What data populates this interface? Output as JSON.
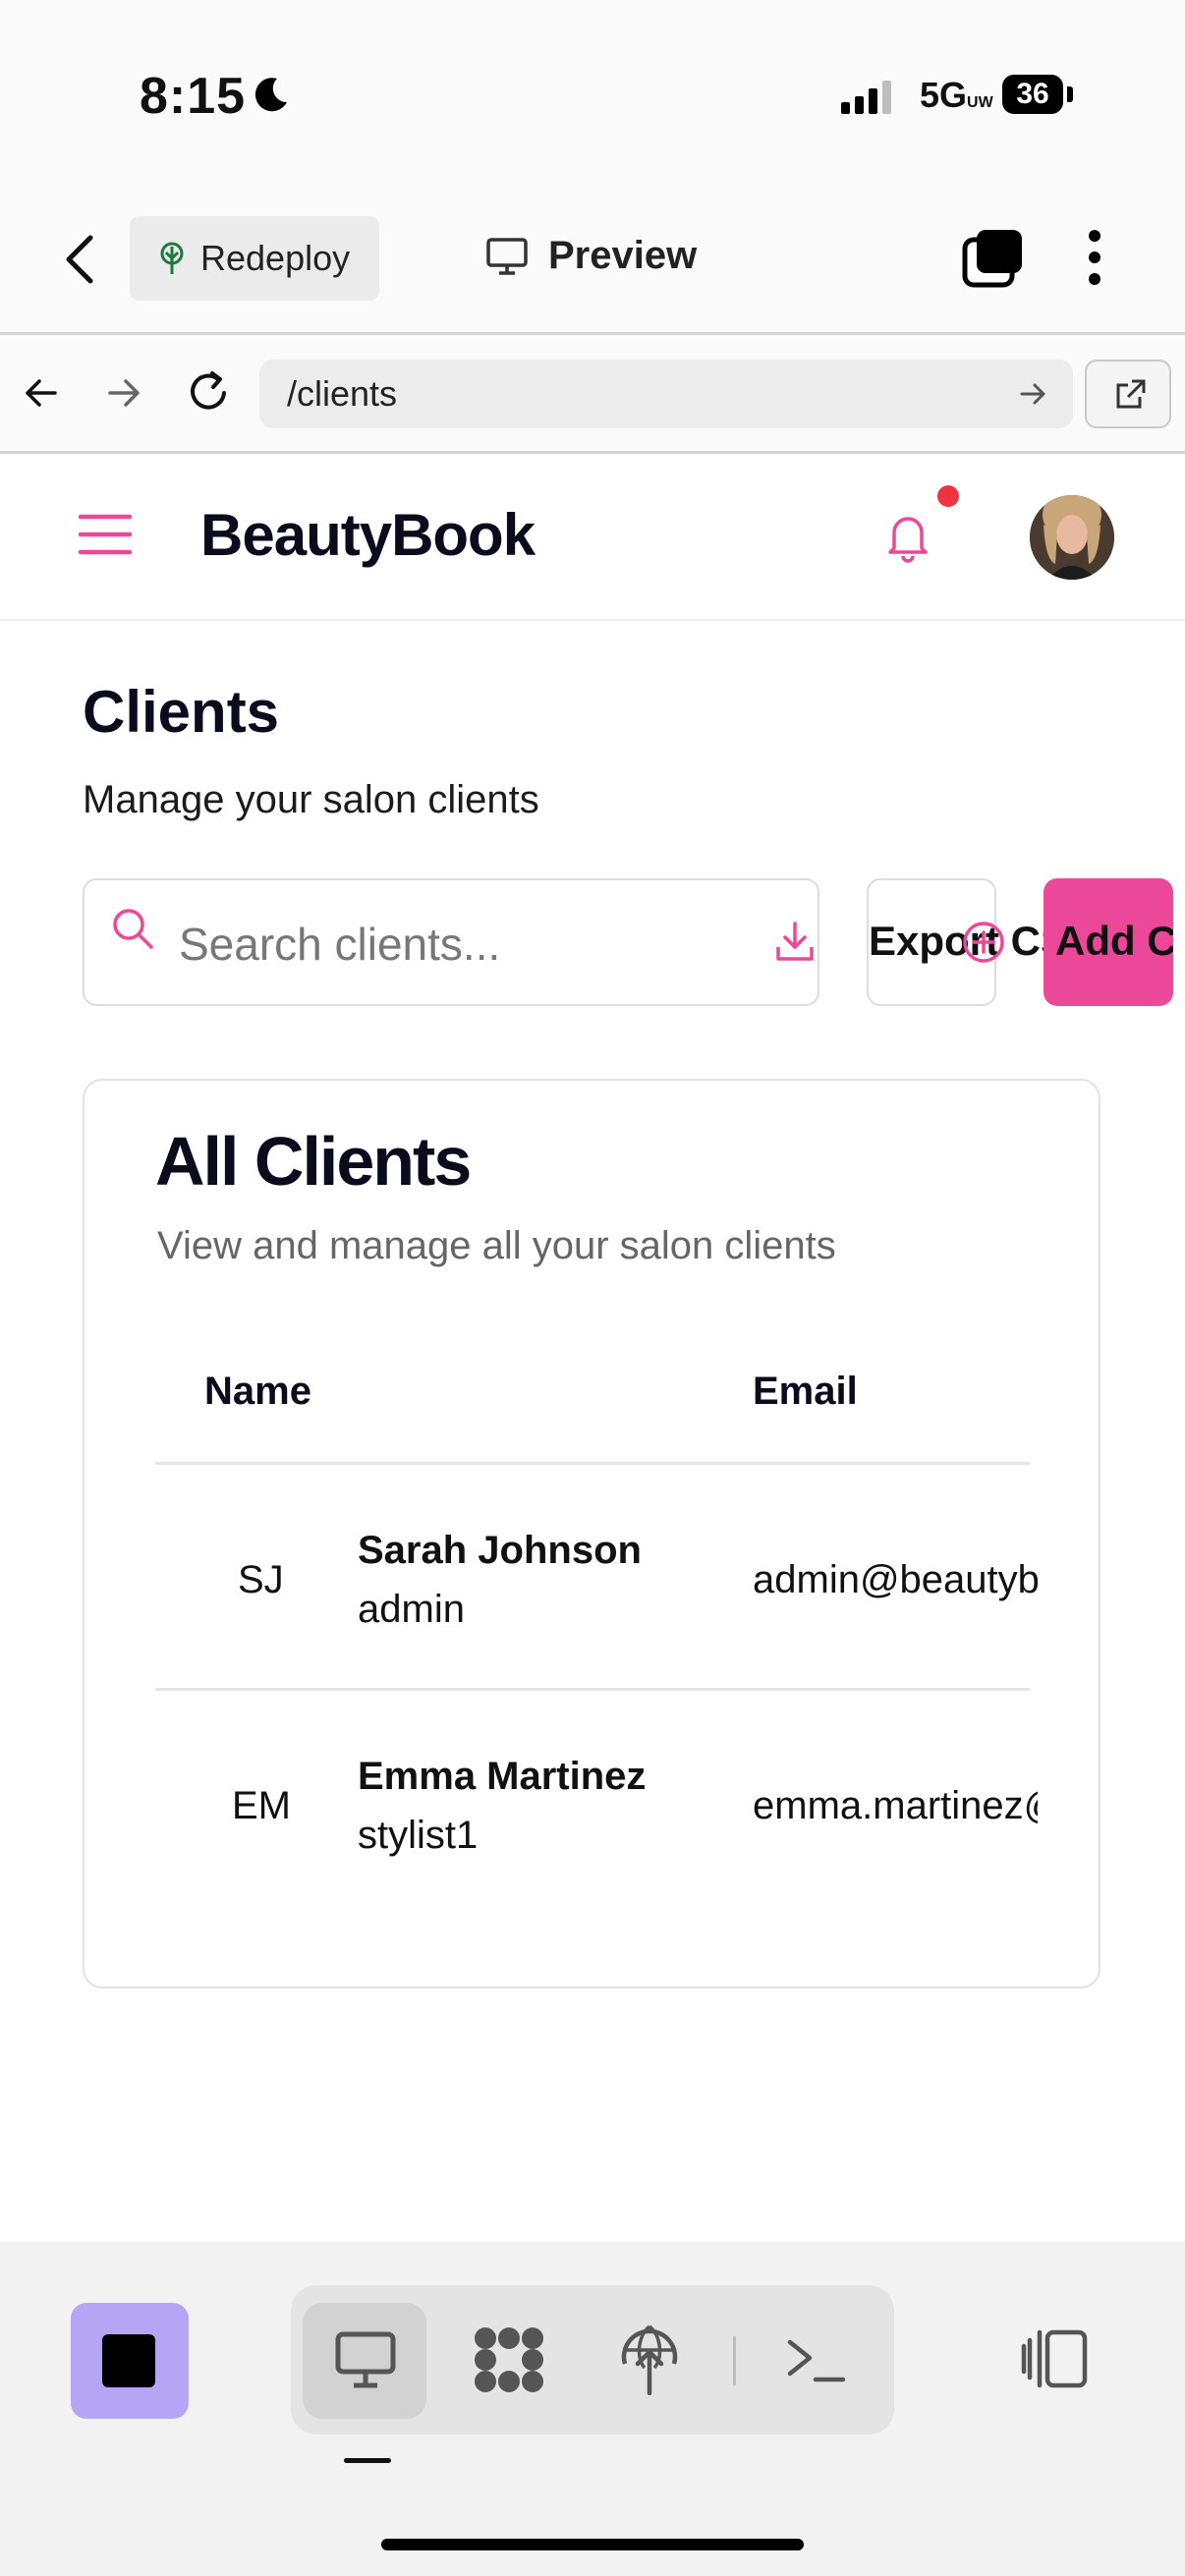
{
  "status_bar": {
    "time": "8:15",
    "network": "5G",
    "network_sup": "UW",
    "battery": "36"
  },
  "toolbar": {
    "redeploy_label": "Redeploy",
    "preview_label": "Preview"
  },
  "browser": {
    "url": "/clients"
  },
  "app": {
    "brand": "BeautyBook",
    "page_title": "Clients",
    "page_subtitle": "Manage your salon clients",
    "search_placeholder": "Search clients...",
    "export_label": "Export CSV",
    "add_label": "Add Client",
    "card_title": "All Clients",
    "card_subtitle": "View and manage all your salon clients",
    "columns": {
      "name": "Name",
      "email": "Email"
    },
    "clients": [
      {
        "initials": "SJ",
        "name": "Sarah Johnson",
        "role": "admin",
        "email": "admin@beautybook.com"
      },
      {
        "initials": "EM",
        "name": "Emma Martinez",
        "role": "stylist1",
        "email": "emma.martinez@beautybook.com"
      }
    ]
  },
  "colors": {
    "accent": "#ec4899",
    "notification": "#ef3340",
    "stop_button": "#b6a5f5"
  }
}
